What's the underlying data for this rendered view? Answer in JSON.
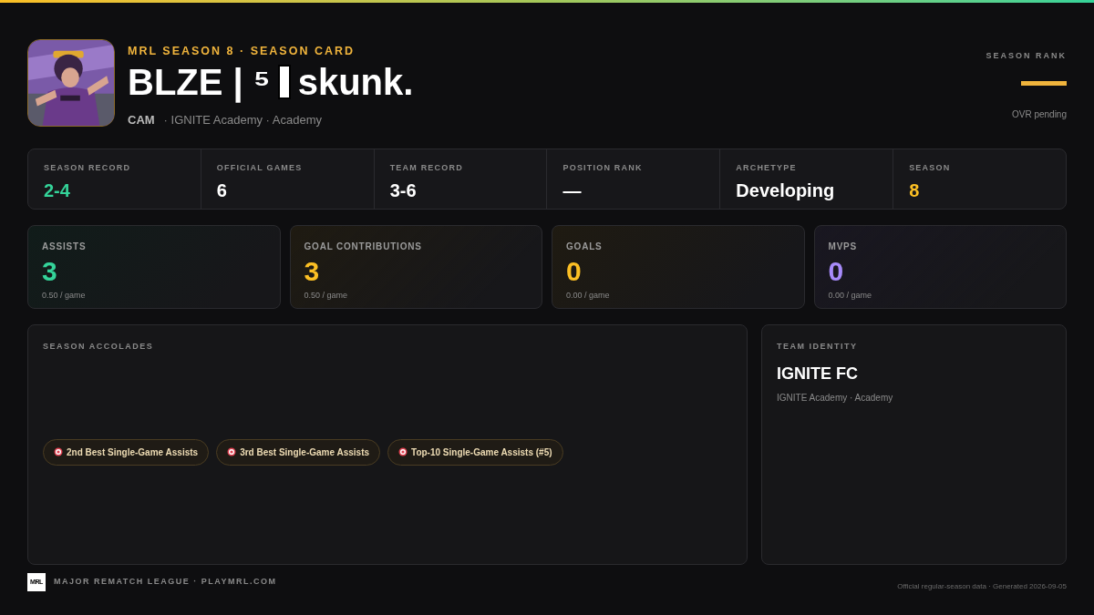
{
  "header": {
    "eyebrow": "MRL SEASON 8 · SEASON CARD",
    "name_before": "BLZE | ⁵",
    "name_after": "skunk.",
    "position": "CAM",
    "team_line": "· IGNITE Academy · Academy"
  },
  "season_rank": {
    "label": "SEASON RANK",
    "note": "OVR pending"
  },
  "summary": [
    {
      "label": "SEASON RECORD",
      "value": "2-4",
      "color": "#34d399"
    },
    {
      "label": "OFFICIAL GAMES",
      "value": "6",
      "color": "#ffffff"
    },
    {
      "label": "TEAM RECORD",
      "value": "3-6",
      "color": "#ffffff"
    },
    {
      "label": "POSITION RANK",
      "value": "—",
      "color": "#ffffff"
    },
    {
      "label": "ARCHETYPE",
      "value": "Developing",
      "color": "#ffffff"
    },
    {
      "label": "SEASON",
      "value": "8",
      "color": "#fbbf24"
    }
  ],
  "stats": [
    {
      "label": "ASSISTS",
      "value": "3",
      "per_game": "0.50 / game",
      "color": "#34d399"
    },
    {
      "label": "GOAL CONTRIBUTIONS",
      "value": "3",
      "per_game": "0.50 / game",
      "color": "#fbbf24"
    },
    {
      "label": "GOALS",
      "value": "0",
      "per_game": "0.00 / game",
      "color": "#fbbf24"
    },
    {
      "label": "MVPS",
      "value": "0",
      "per_game": "0.00 / game",
      "color": "#a78bfa"
    }
  ],
  "accolades": {
    "title": "SEASON ACCOLADES",
    "items": [
      "2nd Best Single-Game Assists",
      "3rd Best Single-Game Assists",
      "Top-10 Single-Game Assists (#5)"
    ]
  },
  "team_identity": {
    "title": "TEAM IDENTITY",
    "name": "IGNITE FC",
    "subtitle": "IGNITE Academy · Academy"
  },
  "footer": {
    "logo": "MRL",
    "brand": "MAJOR REMATCH LEAGUE · PLAYMRL.COM",
    "note": "Official regular-season data · Generated 2026-09-05"
  }
}
